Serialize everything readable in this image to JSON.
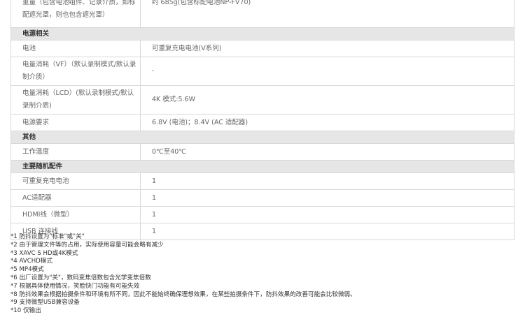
{
  "spec_rows": [
    {
      "type": "row",
      "variant": "first",
      "label": "重量（包含电池组件、记录介质，如标配遮光罩，则也包含遮光罩）",
      "value": "约 685g(包含标配电池NP-FV70)"
    },
    {
      "type": "section",
      "label": "电源相关"
    },
    {
      "type": "row",
      "label": "电池",
      "value": "可重复充电电池(V系列)"
    },
    {
      "type": "row",
      "variant": "tall",
      "label": "电量消耗（VF）（默认录制模式/默认录制介质）",
      "value": "-"
    },
    {
      "type": "row",
      "variant": "tall",
      "label": "电量消耗（LCD）(默认录制模式/默认录制介质)",
      "value": "4K 模式:5.6W"
    },
    {
      "type": "row",
      "label": "电源要求",
      "value": "6.8V (电池)；8.4V (AC 适配器)"
    },
    {
      "type": "section",
      "label": "其他"
    },
    {
      "type": "row",
      "label": "工作温度",
      "value": "0℃至40℃"
    },
    {
      "type": "section",
      "label": "主要随机配件"
    },
    {
      "type": "row",
      "label": "可重复充电电池",
      "value": "1"
    },
    {
      "type": "row",
      "label": "AC适配器",
      "value": "1"
    },
    {
      "type": "row",
      "label": "HDMI线（微型）",
      "value": "1"
    },
    {
      "type": "row",
      "label": "USB 连接线",
      "value": "1"
    }
  ],
  "notes": [
    "*1 防抖设置为\"标准\"或\"关\"",
    "*2 由于管理文件等的占用，实际使用容量可能会略有减少",
    "*3 XAVC S HD或4K模式",
    "*4 AVCHD模式",
    "*5 MP4模式",
    "*6 出厂设置为\"关\"，数码变焦倍数包含光学变焦倍数",
    "*7 根据具体使用情况，笑脸快门功能有可能失效",
    "*8 防抖效果会根据拍摄条件和环境有所不同，因此不能始终确保理想效果，在某些拍摄条件下，防抖效果的改善可能会比较微弱。",
    "*9 支持微型USB兼容设备",
    "*10 仅输出"
  ]
}
